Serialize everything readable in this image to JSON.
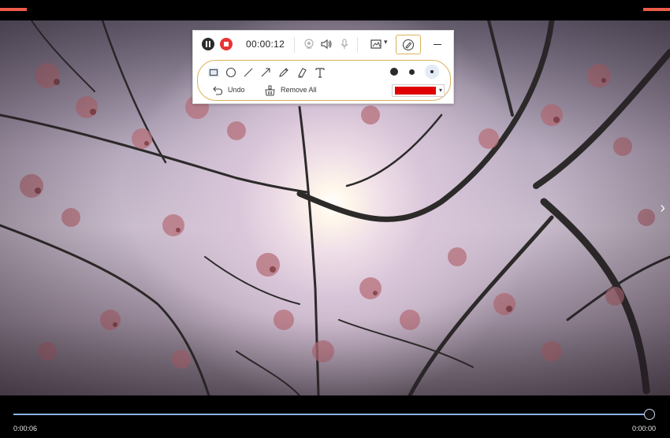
{
  "toolbar": {
    "timer": "00:00:12",
    "undo_label": "Undo",
    "remove_all_label": "Remove All",
    "pen_color": "#e00000",
    "annotate_border_color": "#d9b25a",
    "icons": [
      "pause-icon",
      "stop-icon",
      "webcam-icon",
      "speaker-icon",
      "microphone-icon",
      "screenshot-icon",
      "annotate-icon",
      "minimize-icon",
      "rectangle-icon",
      "ellipse-icon",
      "line-icon",
      "arrow-icon",
      "pencil-icon",
      "highlighter-icon",
      "text-icon",
      "undo-icon",
      "remove-all-icon"
    ]
  },
  "player": {
    "current_time": "0:00:06",
    "total_time": "0:00:00",
    "progress": 1.0,
    "next_icon": "›"
  },
  "accent_color": "#ef5a4a"
}
